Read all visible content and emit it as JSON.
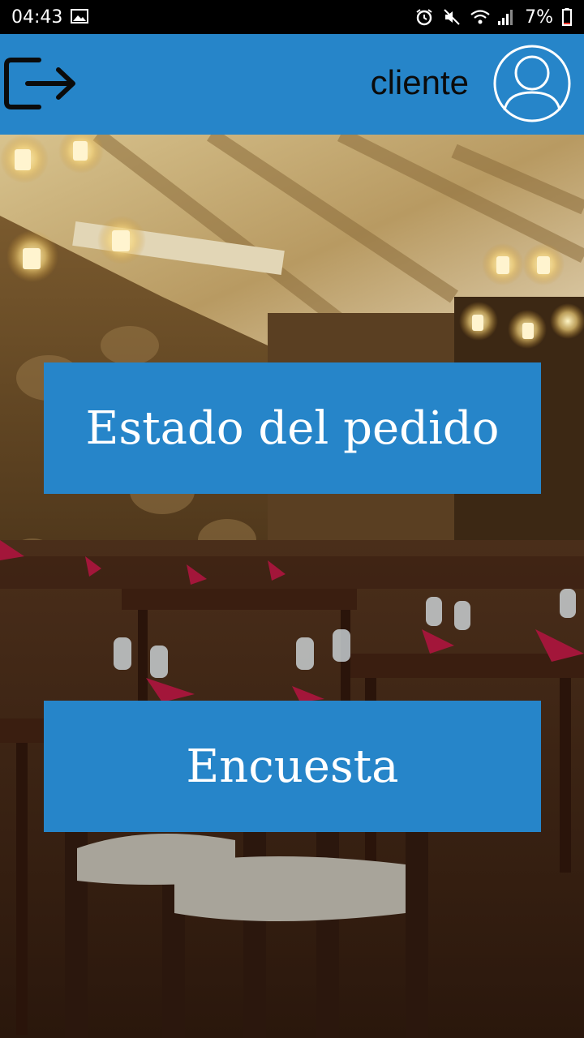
{
  "status_bar": {
    "time": "04:43",
    "battery": "7%",
    "icons": [
      "image-icon",
      "alarm-icon",
      "mute-icon",
      "wifi-icon",
      "signal-icon",
      "battery-icon"
    ]
  },
  "app_bar": {
    "user_label": "cliente",
    "logout_icon": "logout-icon",
    "avatar_icon": "user-avatar-icon",
    "color": "#2685c9"
  },
  "background": {
    "description_icon": "restaurant-background-image"
  },
  "actions": {
    "order_status": "Estado del pedido",
    "survey": "Encuesta"
  }
}
